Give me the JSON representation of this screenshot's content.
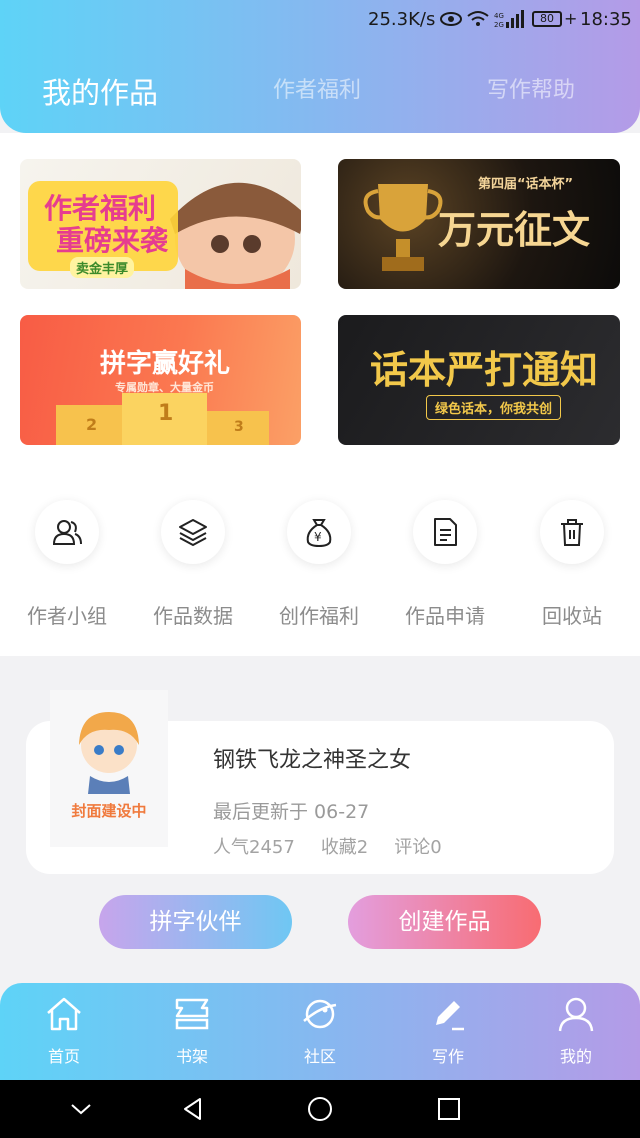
{
  "status_bar": {
    "net_speed": "25.3K/s",
    "battery": "80",
    "time": "18:35",
    "signal": "4G 2G"
  },
  "header": {
    "tabs": [
      {
        "label": "我的作品",
        "active": true
      },
      {
        "label": "作者福利",
        "active": false
      },
      {
        "label": "写作帮助",
        "active": false
      }
    ]
  },
  "banners": [
    {
      "title_line1": "作者福利",
      "title_line2": "重磅来袭",
      "badge": "卖金丰厚"
    },
    {
      "subtitle": "第四届“话本杯”",
      "title": "万元征文"
    },
    {
      "title": "拼字赢好礼",
      "subtitle": "专属勋章、大量金币",
      "podium": [
        "2",
        "1",
        "3"
      ]
    },
    {
      "title": "话本严打通知",
      "subtitle": "绿色话本，你我共创"
    }
  ],
  "features": [
    {
      "label": "作者小组",
      "icon": "group-icon"
    },
    {
      "label": "作品数据",
      "icon": "layers-icon"
    },
    {
      "label": "创作福利",
      "icon": "money-bag-icon"
    },
    {
      "label": "作品申请",
      "icon": "document-icon"
    },
    {
      "label": "回收站",
      "icon": "trash-icon"
    }
  ],
  "work": {
    "cover_text": "封面建设中",
    "title": "钢铁飞龙之神圣之女",
    "updated": "最后更新于 06-27",
    "popularity": "人气2457",
    "favorites": "收藏2",
    "comments": "评论0"
  },
  "actions": {
    "partner_label": "拼字伙伴",
    "create_label": "创建作品"
  },
  "bottom_nav": [
    {
      "label": "首页",
      "icon": "home-icon"
    },
    {
      "label": "书架",
      "icon": "bookshelf-icon"
    },
    {
      "label": "社区",
      "icon": "planet-icon"
    },
    {
      "label": "写作",
      "icon": "pen-icon"
    },
    {
      "label": "我的",
      "icon": "user-icon"
    }
  ],
  "colors": {
    "header_start": "#5ed3f7",
    "header_end": "#b49be7",
    "create_btn": "#f86c72"
  }
}
